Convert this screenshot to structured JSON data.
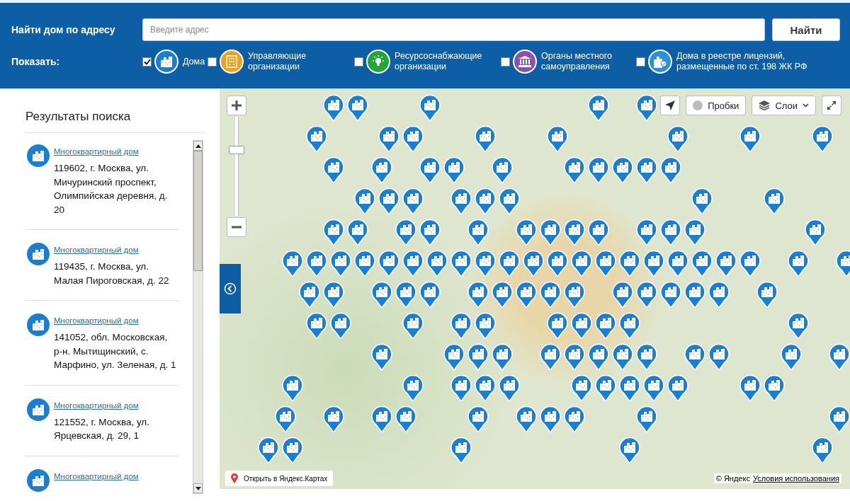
{
  "header": {
    "search_label": "Найти дом по адресу",
    "search": {
      "placeholder": "Введите адрес"
    },
    "search_button": "Найти",
    "show_label": "Показать:",
    "filters": [
      {
        "kind": "houses",
        "label": "Дома",
        "checked": true,
        "color": "#1a7fd0"
      },
      {
        "kind": "management",
        "label": "Управляющие организации",
        "checked": false,
        "color": "#f0a11c"
      },
      {
        "kind": "resources",
        "label": "Ресурсоснабжающие организации",
        "checked": false,
        "color": "#22a637"
      },
      {
        "kind": "government",
        "label": "Органы местного самоуправления",
        "checked": false,
        "color": "#8d4fb3"
      },
      {
        "kind": "licensed",
        "label": "Дома в реестре лицензий, размещенные по ст. 198 ЖК РФ",
        "checked": false,
        "color": "#2d8fd8"
      }
    ]
  },
  "sidebar": {
    "title": "Результаты поиска",
    "results": [
      {
        "type": "Многоквартирный дом",
        "address": "119602, г. Москва, ул. Мичуринский проспект, Олимпийская деревня, д. 20"
      },
      {
        "type": "Многоквартирный дом",
        "address": "119435, г. Москва, ул. Малая Пироговская, д. 22"
      },
      {
        "type": "Многоквартирный дом",
        "address": "141052, обл. Московская, р-н. Мытищинский, с. Марфино, ул. Зеленая, д. 1"
      },
      {
        "type": "Многоквартирный дом",
        "address": "121552, г. Москва, ул. Ярцевская, д. 29, 1"
      },
      {
        "type": "Многоквартирный дом"
      }
    ]
  },
  "map": {
    "zoom": {
      "level": 0.68
    },
    "traffic_button": "Пробки",
    "layers_button": "Слои",
    "open_link": "Открыть в Яндекс.Картах",
    "copyright": "© Яндекс",
    "terms_link": "Условия использования"
  }
}
